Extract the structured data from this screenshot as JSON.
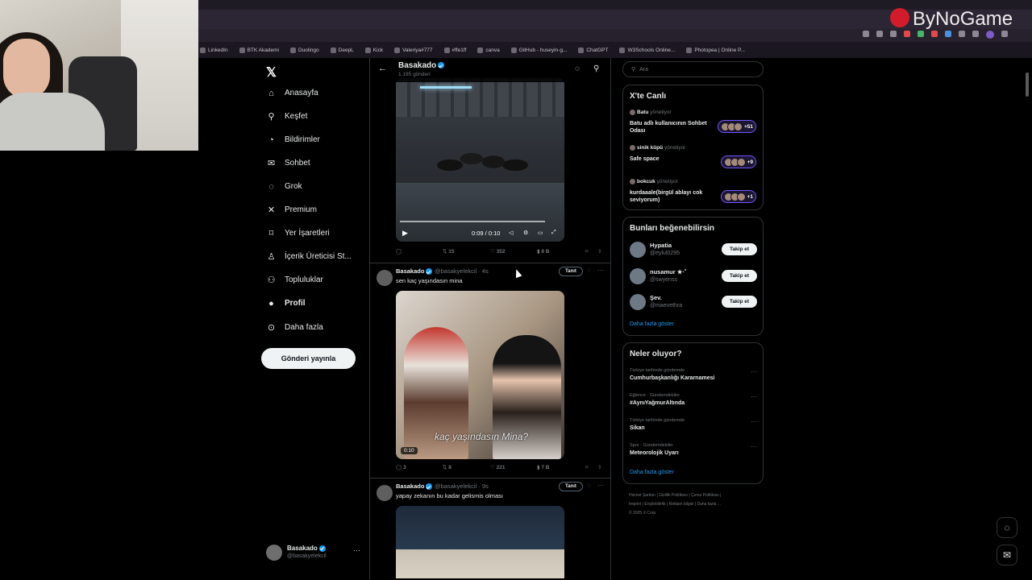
{
  "overlay": {
    "brand": "ByNoGame"
  },
  "bookmarks": [
    "LinkedIn",
    "BTK Akademi",
    "Duolingo",
    "DeepL",
    "Kick",
    "Valeriya#777",
    "#ffe1ff",
    "canva",
    "GitHub - huseyin-g...",
    "ChatGPT",
    "W3Schools Online...",
    "Photopea | Online P..."
  ],
  "nav": {
    "items": [
      {
        "label": "Anasayfa",
        "icon": "home-icon",
        "glyph": "⌂"
      },
      {
        "label": "Keşfet",
        "icon": "search-icon",
        "glyph": "⚲"
      },
      {
        "label": "Bildirimler",
        "icon": "bell-icon",
        "glyph": "🔔"
      },
      {
        "label": "Sohbet",
        "icon": "mail-icon",
        "glyph": "✉"
      },
      {
        "label": "Grok",
        "icon": "grok-icon",
        "glyph": "◌"
      },
      {
        "label": "Premium",
        "icon": "x-premium-icon",
        "glyph": "𝕏"
      },
      {
        "label": "Yer İşaretleri",
        "icon": "bookmark-icon",
        "glyph": "⊓"
      },
      {
        "label": "İçerik Üreticisi St...",
        "icon": "studio-icon",
        "glyph": "♙"
      },
      {
        "label": "Topluluklar",
        "icon": "communities-icon",
        "glyph": "⚇"
      },
      {
        "label": "Profil",
        "icon": "profile-icon",
        "glyph": "●"
      },
      {
        "label": "Daha fazla",
        "icon": "more-icon",
        "glyph": "⊙"
      }
    ],
    "post_button": "Gönderi yayınla",
    "account": {
      "name": "Basakado",
      "handle": "@basakyelekcil"
    }
  },
  "feed": {
    "title": "Basakado",
    "subtitle": "1.195 gönderi",
    "video1": {
      "time": "0:09 / 0:10",
      "stats": {
        "replies": "",
        "reposts": "15",
        "likes": "352",
        "views": "8 B"
      }
    },
    "tweets": [
      {
        "name": "Basakado",
        "handle": "@basakyelekcil",
        "age": "4s",
        "text": "sen kaç yaşındasın mina",
        "promote": "Tanıt",
        "caption": "kaç yaşındasın Mina?",
        "duration": "0:10",
        "stats": {
          "replies": "3",
          "reposts": "8",
          "likes": "221",
          "views": "7 B"
        }
      },
      {
        "name": "Basakado",
        "handle": "@basakyelekcil",
        "age": "9s",
        "text": "yapay zekanın bu kadar gelismis olması",
        "promote": "Tanıt"
      }
    ]
  },
  "right": {
    "search_placeholder": "Ara",
    "live": {
      "title": "X'te Canlı",
      "items": [
        {
          "host": "Batu",
          "role": "yönetiyor",
          "title": "Batu adlı kullanıcının Sohbet Odası",
          "count": "+51"
        },
        {
          "host": "sinik küpü",
          "role": "yönetiyor",
          "title": "Safe space",
          "count": "+9"
        },
        {
          "host": "bokcuk",
          "role": "yönetiyor",
          "title": "kurdaaale(birgül ablayı cok seviyorum)",
          "count": "+1"
        }
      ]
    },
    "suggest": {
      "title": "Bunları beğenebilirsin",
      "follow_label": "Takip et",
      "items": [
        {
          "name": "Hypatia",
          "handle": "@eylul0295"
        },
        {
          "name": "nusamur ★·˚",
          "handle": "@swyenss"
        },
        {
          "name": "Şev.",
          "handle": "@maevethra"
        }
      ],
      "more": "Daha fazla göster"
    },
    "trends": {
      "title": "Neler oluyor?",
      "items": [
        {
          "category": "Türkiye tarihinde gündemde",
          "title": "Cumhurbaşkanlığı Kararnamesi"
        },
        {
          "category": "Eğlence · Gündemdekiler",
          "title": "#AynıYağmurAltında"
        },
        {
          "category": "Türkiye tarihinde gündemde",
          "title": "Sikan"
        },
        {
          "category": "Spor · Gündemdekiler",
          "title": "Meteorolojik Uyarı"
        }
      ],
      "more": "Daha fazla göster"
    },
    "footer": {
      "line1": "Hizmet Şartları | Gizlilik Politikası | Çerez Politikası |",
      "line2": "Imprint | Erişilebilirlik | Reklam bilgisi | Daha fazla ...",
      "line3": "© 2025 X Corp."
    }
  }
}
